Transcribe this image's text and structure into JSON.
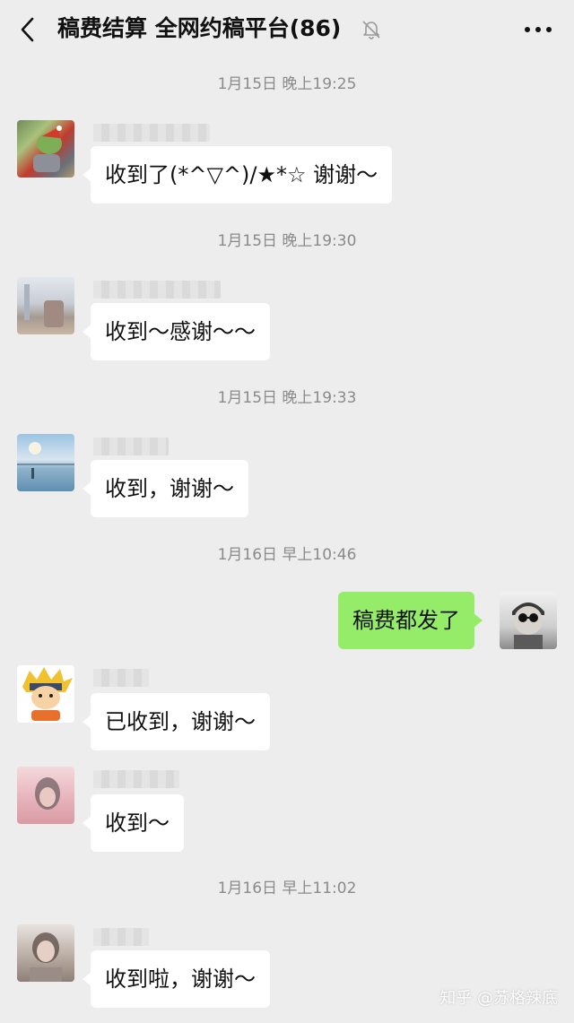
{
  "header": {
    "title": "稿费结算 全网约稿平台(86)",
    "back_icon": "chevron-left-icon",
    "mute_icon": "bell-off-icon",
    "more_icon": "more-dots-icon"
  },
  "timestamps": [
    "1月15日 晚上19:25",
    "1月15日 晚上19:30",
    "1月15日 晚上19:33",
    "1月16日 早上10:46",
    "1月16日 早上11:02"
  ],
  "messages": [
    {
      "from": "other",
      "text": "收到了(*^▽^)/★*☆ 谢谢～"
    },
    {
      "from": "other",
      "text": "收到～感谢～～"
    },
    {
      "from": "other",
      "text": "收到，谢谢～"
    },
    {
      "from": "self",
      "text": "稿费都发了"
    },
    {
      "from": "other",
      "text": "已收到，谢谢～"
    },
    {
      "from": "other",
      "text": "收到～"
    },
    {
      "from": "other",
      "text": "收到啦，谢谢～"
    }
  ],
  "watermark": "知乎 @苏格辣底",
  "colors": {
    "background": "#ededed",
    "self_bubble": "#95ec69",
    "other_bubble": "#ffffff",
    "timestamp": "#8a8a8a"
  }
}
